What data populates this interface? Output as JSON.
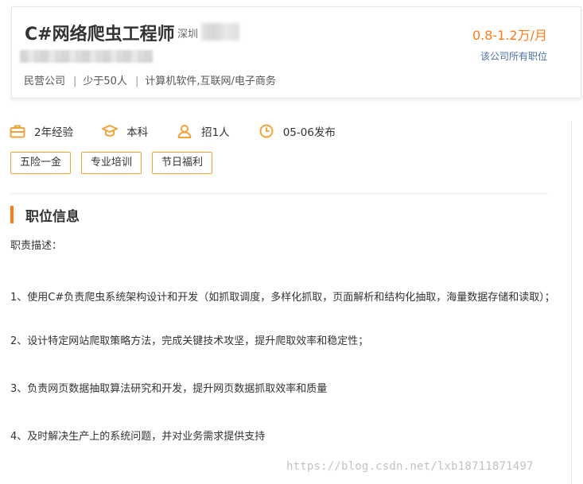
{
  "job": {
    "title": "C#网络爬虫工程师",
    "city": "深圳",
    "salary": "0.8-1.2万/月",
    "all_positions_link": "该公司所有职位"
  },
  "company": {
    "type": "民营公司",
    "sep1": "|",
    "size": "少于50人",
    "sep2": "|",
    "industry": "计算机软件,互联网/电子商务"
  },
  "requirements": {
    "experience": "2年经验",
    "education": "本科",
    "headcount": "招1人",
    "publish_date": "05-06发布"
  },
  "benefits": [
    "五险一金",
    "专业培训",
    "节日福利"
  ],
  "section": {
    "title": "职位信息",
    "desc_heading": "职责描述：",
    "items": [
      "1、使用C#负责爬虫系统架构设计和开发（如抓取调度，多样化抓取，页面解析和结构化抽取，海量数据存储和读取）；",
      "2、设计特定网站爬取策略方法，完成关键技术攻坚，提升爬取效率和稳定性；",
      "3、负责网页数据抽取算法研究和开发，提升网页数据抓取效率和质量",
      "4、及时解决生产上的系统问题，并对业务需求提供支持"
    ]
  },
  "watermark": "https://blog.csdn.net/lxb18711871497",
  "colors": {
    "accent_orange": "#ff7a1a",
    "tag_border": "#f0a33a",
    "link_blue": "#4a6fa5"
  },
  "icons": [
    "briefcase-icon",
    "graduation-cap-icon",
    "person-icon",
    "clock-icon"
  ]
}
